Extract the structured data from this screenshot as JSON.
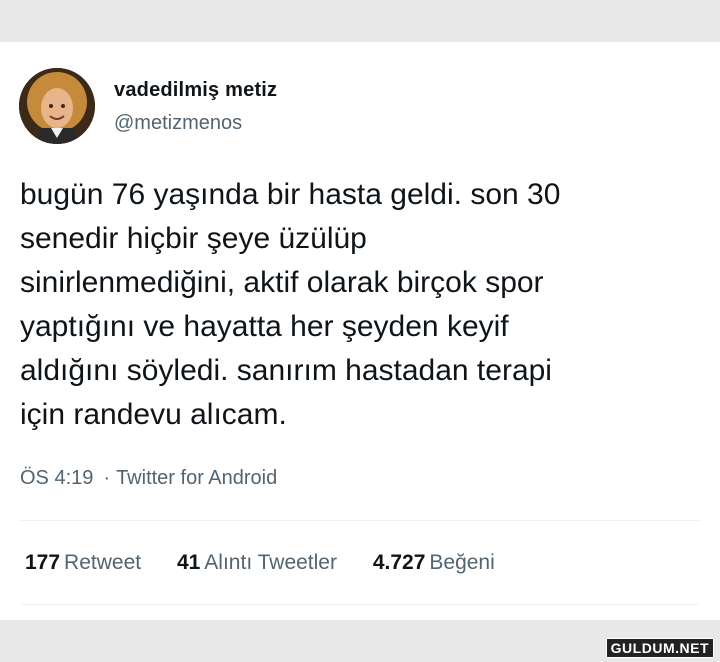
{
  "author": {
    "display_name": "vadedilmiş metiz",
    "handle": "@metizmenos",
    "avatar_icon": "profile-photo"
  },
  "tweet": {
    "lines": [
      "bugün 76 yaşında bir hasta geldi. son 30",
      "senedir hiçbir şeye üzülüp",
      "sinirlenmediğini, aktif olarak birçok spor",
      "yaptığını ve hayatta her şeyden keyif",
      "aldığını söyledi. sanırım hastadan terapi",
      "için randevu alıcam."
    ]
  },
  "meta": {
    "time": "ÖS 4:19",
    "separator": "·",
    "source": "Twitter for Android"
  },
  "stats": [
    {
      "count": "177",
      "label": "Retweet"
    },
    {
      "count": "41",
      "label": "Alıntı Tweetler"
    },
    {
      "count": "4.727",
      "label": "Beğeni"
    }
  ],
  "watermark": "GULDUM.NET"
}
